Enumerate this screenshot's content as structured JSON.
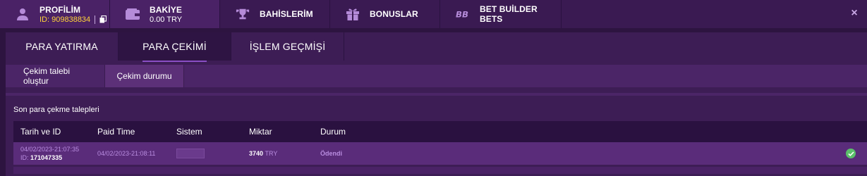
{
  "topbar": {
    "profile": {
      "title": "PROFİLİM",
      "id_text": "ID: 909838834"
    },
    "balance": {
      "title": "BAKİYE",
      "amount": "0.00 TRY"
    },
    "bets": {
      "title": "BAHİSLERİM"
    },
    "bonus": {
      "title": "BONUSLAR"
    },
    "builder": {
      "title": "BET BUİLDER BETS"
    },
    "close": "×"
  },
  "main_tabs": [
    "PARA YATIRMA",
    "PARA ÇEKİMİ",
    "İŞLEM GEÇMİŞİ"
  ],
  "sub_tabs": [
    "Çekim talebi oluştur",
    "Çekim durumu"
  ],
  "section_title": "Son para çekme talepleri",
  "table": {
    "headers": [
      "Tarih ve ID",
      "Paid Time",
      "Sistem",
      "Miktar",
      "Durum"
    ],
    "rows": [
      {
        "date": "04/02/2023-21:07:35",
        "id_label": "ID:",
        "id_value": "171047335",
        "paid_time": "04/02/2023-21:08:11",
        "amount": "3740",
        "currency": "TRY",
        "status": "Ödendi"
      }
    ]
  },
  "colors": {
    "background": "#2d1440",
    "accent_yellow": "#ffd23a",
    "status_success": "#5bbf6a"
  }
}
